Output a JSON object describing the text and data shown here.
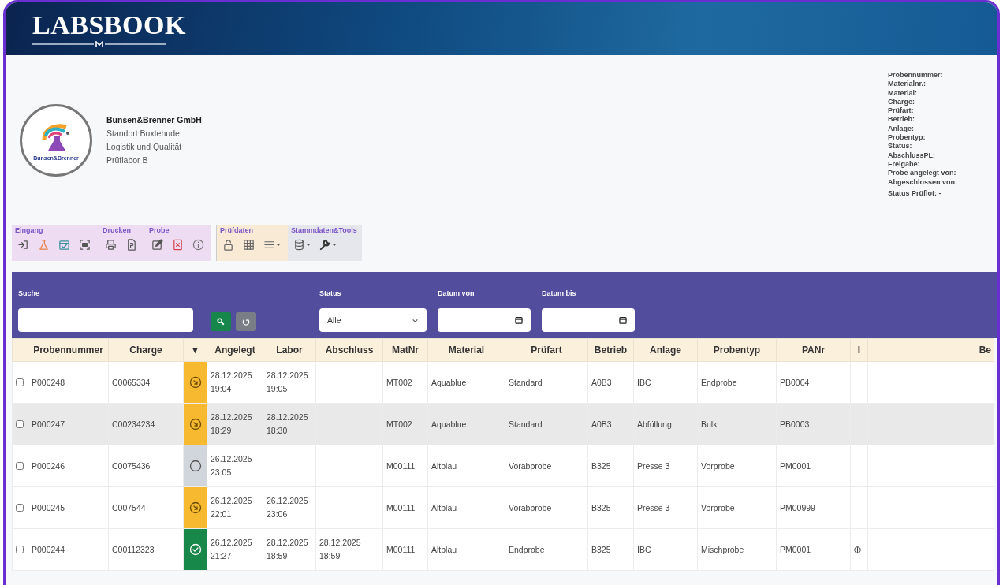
{
  "app": {
    "title": "LABSBOOK"
  },
  "company": {
    "logo_text": "Bunsen&Brenner",
    "name": "Bunsen&Brenner GmbH",
    "lines": [
      "Standort Buxtehude",
      "Logistik und Qualität",
      "Prüflabor B"
    ]
  },
  "details": [
    "Probennummer:",
    "Materialnr.:",
    "Material:",
    "Charge:",
    "Prüfart:",
    "Betrieb:",
    "Anlage:",
    "Probentyp:",
    "Status:",
    "AbschlussPL:",
    "Freigabe:",
    "Probe angelegt von:",
    "Abgeschlossen von:",
    "Status Prüflot: -"
  ],
  "toolbar": {
    "groups": [
      {
        "kind": "sample",
        "sections": [
          {
            "label": "Eingang"
          },
          {
            "label": "Drucken"
          },
          {
            "label": "Probe"
          }
        ]
      },
      {
        "kind": "testdata",
        "sections": [
          {
            "label": "Prüfdaten"
          }
        ]
      },
      {
        "kind": "tools",
        "sections": [
          {
            "label": "Stammdaten&Tools"
          }
        ]
      }
    ]
  },
  "filters": {
    "search": {
      "label": "Suche"
    },
    "status": {
      "label": "Status",
      "value": "Alle"
    },
    "date_from": {
      "label": "Datum von"
    },
    "date_to": {
      "label": "Datum bis"
    }
  },
  "table": {
    "columns": [
      "",
      "Probennummer",
      "Charge",
      "▼",
      "Angelegt",
      "Labor",
      "Abschluss",
      "MatNr",
      "Material",
      "Prüfart",
      "Betrieb",
      "Anlage",
      "Probentyp",
      "PANr",
      "I",
      "Be"
    ],
    "rows": [
      {
        "checked": false,
        "selected": false,
        "kind": "in_progress",
        "note": false,
        "cells": [
          "",
          "P000248",
          "C0065334",
          "",
          "28.12.2025 19:04",
          "28.12.2025 19:05",
          "",
          "MT002",
          "Aquablue",
          "Standard",
          "A0B3",
          "IBC",
          "Endprobe",
          "PB0004"
        ]
      },
      {
        "checked": false,
        "selected": true,
        "kind": "in_progress",
        "note": false,
        "cells": [
          "",
          "P000247",
          "C00234234",
          "",
          "28.12.2025 18:29",
          "28.12.2025 18:30",
          "",
          "MT002",
          "Aquablue",
          "Standard",
          "A0B3",
          "Abfüllung",
          "Bulk",
          "PB0003"
        ]
      },
      {
        "checked": false,
        "selected": false,
        "kind": "open",
        "note": false,
        "cells": [
          "",
          "P000246",
          "C0075436",
          "",
          "26.12.2025 23:05",
          "",
          "",
          "M00111",
          "Altblau",
          "Vorabprobe",
          "B325",
          "Presse 3",
          "Vorprobe",
          "PM0001"
        ]
      },
      {
        "checked": false,
        "selected": false,
        "kind": "in_progress",
        "note": false,
        "cells": [
          "",
          "P000245",
          "C007544",
          "",
          "26.12.2025 22:01",
          "26.12.2025 23:06",
          "",
          "M00111",
          "Altblau",
          "Vorabprobe",
          "B325",
          "Presse 3",
          "Vorprobe",
          "PM00999"
        ]
      },
      {
        "checked": false,
        "selected": false,
        "kind": "done",
        "note": true,
        "cells": [
          "",
          "P000244",
          "C00112323",
          "",
          "26.12.2025 21:27",
          "28.12.2025 18:59",
          "28.12.2025 18:59",
          "M00111",
          "Altblau",
          "Endprobe",
          "B325",
          "IBC",
          "Mischprobe",
          "PM0001"
        ]
      }
    ]
  }
}
